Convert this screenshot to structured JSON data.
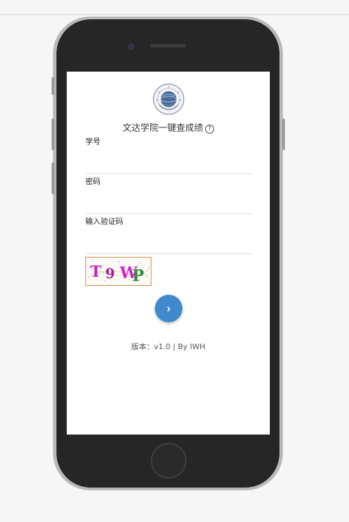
{
  "app": {
    "title": "文达学院一键查成绩",
    "help_icon": "?",
    "version_text": "版本：v1.0 | By IWH"
  },
  "form": {
    "student_id_label": "学号",
    "student_id_value": "",
    "password_label": "密码",
    "password_value": "",
    "captcha_label": "输入验证码",
    "captcha_value": "",
    "captcha_text": "T9WP",
    "submit_icon": "chevron-right-icon",
    "submit_glyph": "›"
  },
  "colors": {
    "accent": "#3f89cc",
    "phone_body": "#262626",
    "screen": "#ffffff"
  }
}
